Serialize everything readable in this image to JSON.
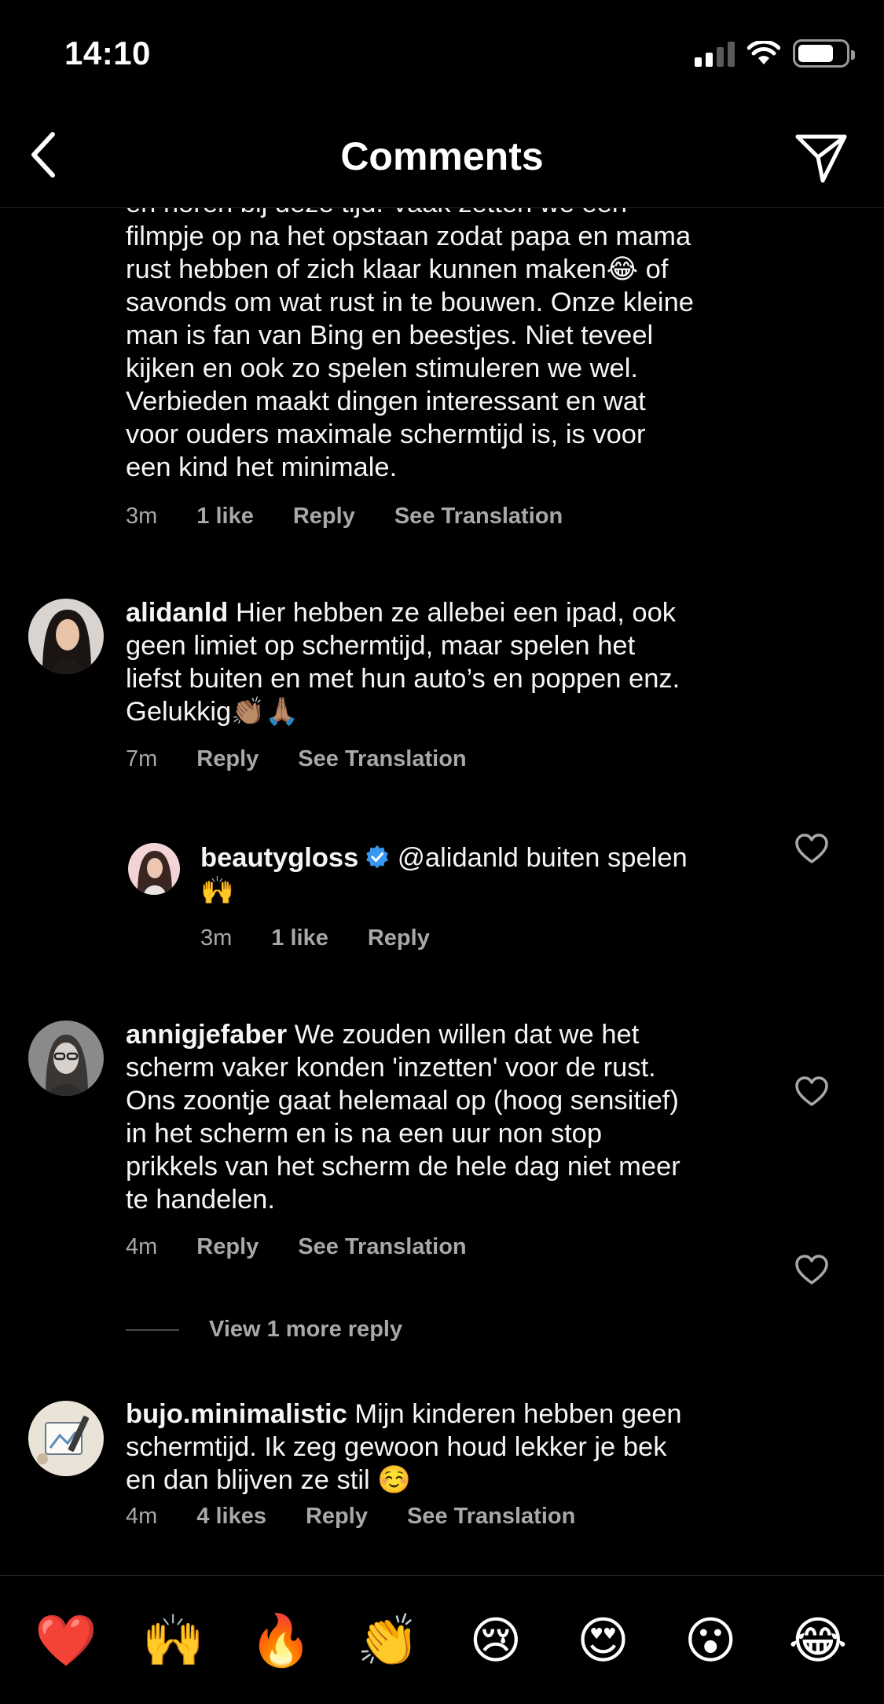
{
  "status_bar": {
    "time": "14:10"
  },
  "header": {
    "title": "Comments"
  },
  "comments": [
    {
      "lines": [
        "en horen bij deze tijd. Vaak zetten we een",
        "filmpje op na het opstaan zodat papa en mama",
        "rust hebben of zich klaar kunnen maken😂 of",
        "savonds om wat rust in te bouwen. Onze kleine",
        "man is fan van Bing en beestjes. Niet teveel",
        "kijken en ook zo spelen stimuleren we wel.",
        "Verbieden maakt dingen interessant en wat",
        "voor ouders maximale schermtijd is, is voor",
        "een kind het minimale."
      ],
      "time": "3m",
      "likes": "1 like",
      "reply": "Reply",
      "translate": "See Translation"
    },
    {
      "username": "alidanld",
      "text_first": "Hier hebben ze allebei een ipad, ook",
      "lines": [
        "geen limiet op schermtijd, maar spelen het",
        "liefst buiten en met hun auto’s en poppen enz.",
        "Gelukkig👏🏽🙏🏽"
      ],
      "time": "7m",
      "reply": "Reply",
      "translate": "See Translation"
    },
    {
      "username": "beautygloss",
      "text_first": "@alidanld buiten spelen",
      "lines": [
        "🙌"
      ],
      "time": "3m",
      "likes": "1 like",
      "reply": "Reply"
    },
    {
      "username": "annigjefaber",
      "text_first": "We zouden willen dat we het",
      "lines": [
        "scherm vaker konden 'inzetten' voor de rust.",
        "Ons zoontje gaat helemaal op (hoog sensitief)",
        "in het scherm en is na een uur non stop",
        "prikkels van het scherm de hele dag niet meer",
        "te handelen."
      ],
      "time": "4m",
      "reply": "Reply",
      "translate": "See Translation",
      "view_more": "View 1 more reply"
    },
    {
      "username": "bujo.minimalistic",
      "text_first": "Mijn kinderen hebben geen",
      "lines": [
        "schermtijd. Ik zeg gewoon houd lekker je bek",
        "en dan blijven ze stil ☺️"
      ],
      "time": "4m",
      "likes": "4 likes",
      "reply": "Reply",
      "translate": "See Translation"
    }
  ],
  "emoji_bar": [
    "❤️",
    "🙌",
    "🔥",
    "👏",
    "😢",
    "😍",
    "😮",
    "😂"
  ],
  "colors": {
    "background": "#000000",
    "text": "#f5f5f5",
    "secondary": "#a8a8a8",
    "verified": "#3897f0"
  },
  "icons": [
    "back-chevron-icon",
    "send-icon",
    "heart-icon",
    "verified-badge-icon",
    "signal-icon",
    "wifi-icon",
    "battery-icon"
  ]
}
